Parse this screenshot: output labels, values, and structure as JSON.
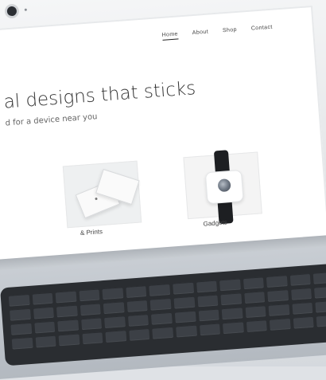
{
  "website": {
    "nav": [
      {
        "label": "Home",
        "active": true
      },
      {
        "label": "About",
        "active": false
      },
      {
        "label": "Shop",
        "active": false
      },
      {
        "label": "Contact",
        "active": false
      }
    ],
    "hero": {
      "headline": "al designs that sticks",
      "subhead": "d for a device near you"
    },
    "items": [
      {
        "caption": "& Prints",
        "image": "business-cards"
      },
      {
        "caption": "Gadgets",
        "image": "smartwatch"
      }
    ]
  },
  "colors": {
    "screen_background": "#ffffff",
    "text": "#333333",
    "laptop_silver": "#e6e8ea",
    "keyboard": "#2a2d31"
  }
}
